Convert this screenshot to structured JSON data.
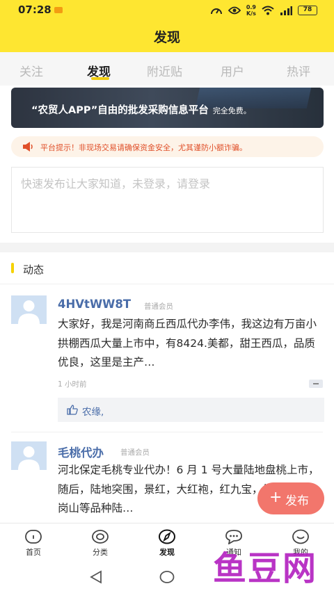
{
  "status_bar": {
    "time": "07:28",
    "speed_top": "0.9",
    "speed_bottom": "K/s",
    "network": "4G",
    "battery": "78"
  },
  "header": {
    "title": "发现"
  },
  "tabs": [
    {
      "label": "关注"
    },
    {
      "label": "发现"
    },
    {
      "label": "附近贴"
    },
    {
      "label": "用户"
    },
    {
      "label": "热评"
    }
  ],
  "active_tab": "发现",
  "banner": {
    "text": "“农贸人APP”自由的批发采购信息平台",
    "note": "完全免费。"
  },
  "notice": {
    "text": "平台提示！非现场交易请确保资金安全，尤其谨防小额诈骗。"
  },
  "compose": {
    "placeholder": "快速发布让大家知道，未登录，请登录"
  },
  "section": {
    "title": "动态"
  },
  "posts": [
    {
      "username": "4HVtWW8T",
      "badge": "普通会员",
      "text": "大家好，我是河南商丘西瓜代办李伟，我这边有万亩小拱棚西瓜大量上市中，有8424.美都，甜王西瓜，品质优良，这里是主产…",
      "time": "1 小时前",
      "likes": "农缘,"
    },
    {
      "username": "毛桃代办",
      "badge": "普通会员",
      "text": "河北保定毛桃专业代办！6 月 1 号大量陆地盘桃上市，随后，陆地突围，景红，大红袍，红九宝，绿花九，红岗山等品种陆…"
    }
  ],
  "fab": {
    "label": "发布"
  },
  "bottom_nav": [
    {
      "label": "首页",
      "icon": "home-icon"
    },
    {
      "label": "分类",
      "icon": "category-icon"
    },
    {
      "label": "发现",
      "icon": "compass-icon"
    },
    {
      "label": "通知",
      "icon": "message-icon"
    },
    {
      "label": "我的",
      "icon": "smile-icon"
    }
  ],
  "watermark": {
    "text": "鱼豆网"
  },
  "colors": {
    "brand_yellow": "#fee631",
    "fab_red": "#f2766c",
    "link_blue": "#4a6da9",
    "notice_red": "#e0502a"
  }
}
